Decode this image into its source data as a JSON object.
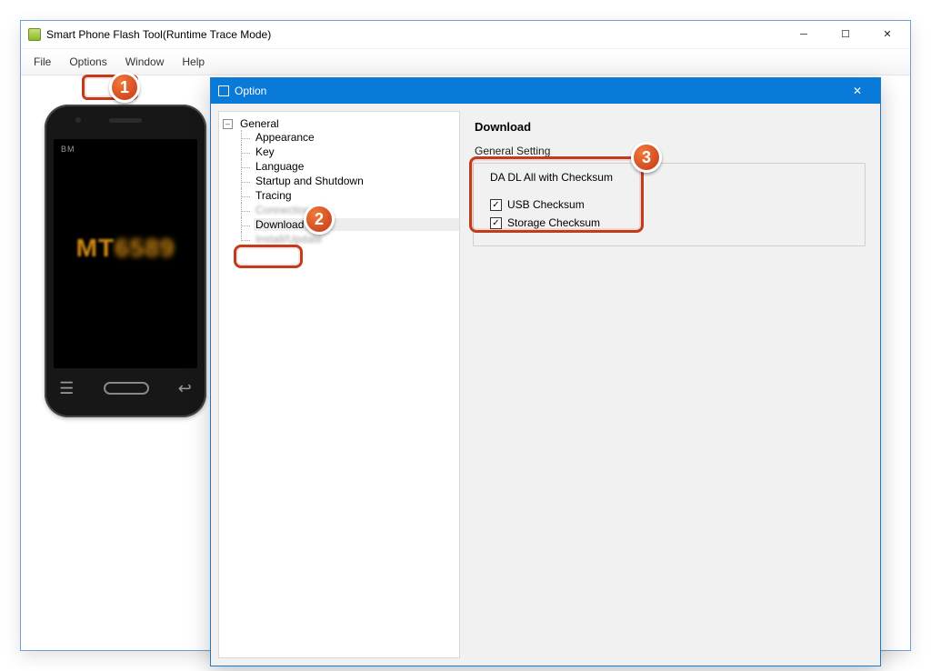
{
  "window": {
    "title": "Smart Phone Flash Tool(Runtime Trace Mode)"
  },
  "menubar": {
    "items": [
      "File",
      "Options",
      "Window",
      "Help"
    ]
  },
  "phone": {
    "brand_badge": "BM",
    "screen_text": "MT"
  },
  "dialog": {
    "title": "Option",
    "tree": {
      "general": "General",
      "children": [
        "Appearance",
        "Key",
        "Language",
        "Startup and Shutdown",
        "Tracing"
      ],
      "hidden_item": "Connection",
      "download": "Download",
      "hidden_item2": "Install/Update"
    },
    "content": {
      "heading": "Download",
      "subheading": "General Setting",
      "group_legend": "DA DL All with Checksum",
      "usb_checksum_label": "USB Checksum",
      "storage_checksum_label": "Storage Checksum",
      "usb_checksum_checked": true,
      "storage_checksum_checked": true
    }
  },
  "callouts": {
    "b1": "1",
    "b2": "2",
    "b3": "3"
  }
}
